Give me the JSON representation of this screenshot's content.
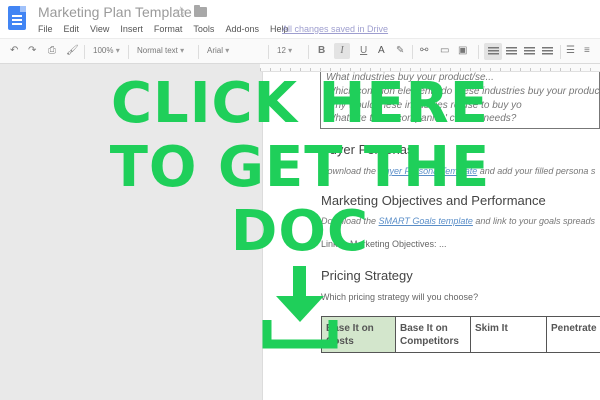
{
  "window": {
    "title": "Marketing Plan Template",
    "saved_status": "All changes saved in Drive"
  },
  "menu": [
    "File",
    "Edit",
    "View",
    "Insert",
    "Format",
    "Tools",
    "Add-ons",
    "Help"
  ],
  "toolbar": {
    "zoom": "100%",
    "style": "Normal text",
    "font": "Arial",
    "size": "12",
    "bold": "B",
    "italic": "I",
    "underline": "U"
  },
  "doc": {
    "questions": [
      "What industries buy your product/se...",
      "Which common elements do these industries buy your product/se",
      "Why would these industries refuse to buy yo",
      "What are these companies' current needs?"
    ],
    "buyer_personas": {
      "heading": "Buyer Personas",
      "text_pre": "Download the ",
      "link": "Buyer Persona Template",
      "text_post": " and add your filled persona s"
    },
    "objectives": {
      "heading": "Marketing Objectives and Performance",
      "text_pre": "Download the ",
      "link": "SMART Goals template",
      "text_post": " and link to your goals spreads",
      "link_label": "Link to Marketing Objectives: ..."
    },
    "pricing": {
      "heading": "Pricing Strategy",
      "question": "Which pricing strategy will you choose?",
      "options": [
        "Base It on Costs",
        "Base It on Competitors",
        "Skim It",
        "Penetrate"
      ]
    }
  },
  "overlay": {
    "cta_lines": [
      "CLICK HERE",
      "TO GET THE",
      "DOC"
    ],
    "icon": "download-icon",
    "color": "#1fcf5a"
  }
}
